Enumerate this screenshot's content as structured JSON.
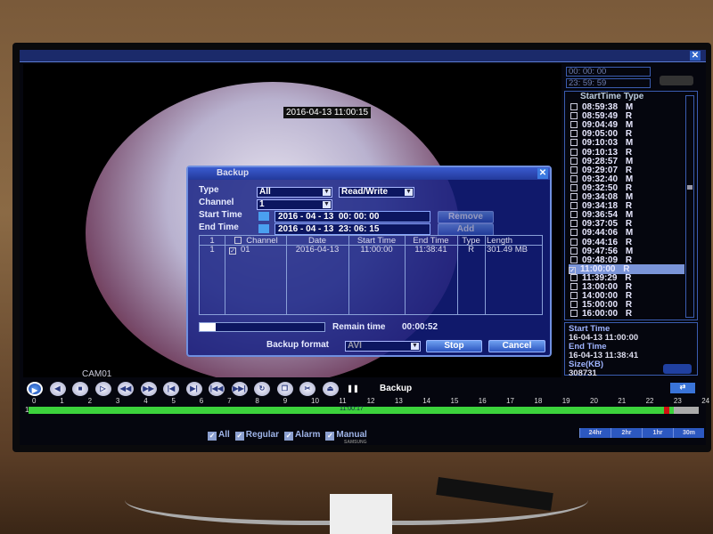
{
  "video": {
    "timestamp": "2016-04-13 11:00:15",
    "camera_label": "CAM01"
  },
  "dialog": {
    "title": "Backup",
    "type_label": "Type",
    "type_value": "All",
    "mode_value": "Read/Write",
    "channel_label": "Channel",
    "channel_value": "1",
    "start_label": "Start Time",
    "start_date": "2016 - 04 - 13",
    "start_time": "00: 00: 00",
    "end_label": "End Time",
    "end_date": "2016 - 04 - 13",
    "end_time": "23: 06: 15",
    "remove_label": "Remove",
    "add_label": "Add",
    "table": {
      "headers": [
        "1",
        "Channel",
        "Date",
        "Start Time",
        "End Time",
        "Type",
        "Length"
      ],
      "rows": [
        {
          "index": "1",
          "channel": "01",
          "date": "2016-04-13",
          "start": "11:00:00",
          "end": "11:38:41",
          "type": "R",
          "length": "301.49 MB",
          "checked": true
        }
      ]
    },
    "progress_percent": 13,
    "remain_label": "Remain time",
    "remain_value": "00:00:52",
    "format_label": "Backup format",
    "format_value": "AVI",
    "stop_label": "Stop",
    "cancel_label": "Cancel"
  },
  "right_panel": {
    "search_start": "00: 00: 00",
    "search_end": "23: 59: 59",
    "list_header": "StartTime Type",
    "items": [
      {
        "time": "08:59:38",
        "type": "M"
      },
      {
        "time": "08:59:49",
        "type": "R"
      },
      {
        "time": "09:04:49",
        "type": "M"
      },
      {
        "time": "09:05:00",
        "type": "R"
      },
      {
        "time": "09:10:03",
        "type": "M"
      },
      {
        "time": "09:10:13",
        "type": "R"
      },
      {
        "time": "09:28:57",
        "type": "M"
      },
      {
        "time": "09:29:07",
        "type": "R"
      },
      {
        "time": "09:32:40",
        "type": "M"
      },
      {
        "time": "09:32:50",
        "type": "R"
      },
      {
        "time": "09:34:08",
        "type": "M"
      },
      {
        "time": "09:34:18",
        "type": "R"
      },
      {
        "time": "09:36:54",
        "type": "M"
      },
      {
        "time": "09:37:05",
        "type": "R"
      },
      {
        "time": "09:44:06",
        "type": "M"
      },
      {
        "time": "09:44:16",
        "type": "R"
      },
      {
        "time": "09:47:56",
        "type": "M"
      },
      {
        "time": "09:48:09",
        "type": "R"
      },
      {
        "time": "11:00:00",
        "type": "R",
        "selected": true
      },
      {
        "time": "11:39:29",
        "type": "R"
      },
      {
        "time": "13:00:00",
        "type": "R"
      },
      {
        "time": "14:00:00",
        "type": "R"
      },
      {
        "time": "15:00:00",
        "type": "R"
      },
      {
        "time": "16:00:00",
        "type": "R"
      }
    ],
    "info": {
      "start_label": "Start Time",
      "start_value": "16-04-13 11:00:00",
      "end_label": "End Time",
      "end_value": "16-04-13 11:38:41",
      "size_label": "Size(KB)",
      "size_value": "308731"
    }
  },
  "toolbar": {
    "buttons": [
      "play",
      "reverse",
      "stop",
      "slow",
      "rewind",
      "fast-forward",
      "prev-frame",
      "next-frame",
      "prev-file",
      "next-file",
      "loop",
      "fullscreen",
      "clip",
      "backup",
      "pause"
    ],
    "title": "Backup"
  },
  "timeline": {
    "channel": "1",
    "hours": [
      "0",
      "1",
      "2",
      "3",
      "4",
      "5",
      "6",
      "7",
      "8",
      "9",
      "10",
      "11",
      "12",
      "13",
      "14",
      "15",
      "16",
      "17",
      "18",
      "19",
      "20",
      "21",
      "22",
      "23",
      "24"
    ],
    "cursor_label": "11:00:17",
    "colors": {
      "regular": "#3cd23c",
      "alarm": "#d01010",
      "empty": "#aaaaaa"
    }
  },
  "filters": [
    {
      "label": "All",
      "checked": true
    },
    {
      "label": "Regular",
      "checked": true
    },
    {
      "label": "Alarm",
      "checked": true
    },
    {
      "label": "Manual",
      "checked": true
    }
  ],
  "zoom_options": [
    "24hr",
    "2hr",
    "1hr",
    "30m"
  ],
  "tv_brand": "SAMSUNG"
}
